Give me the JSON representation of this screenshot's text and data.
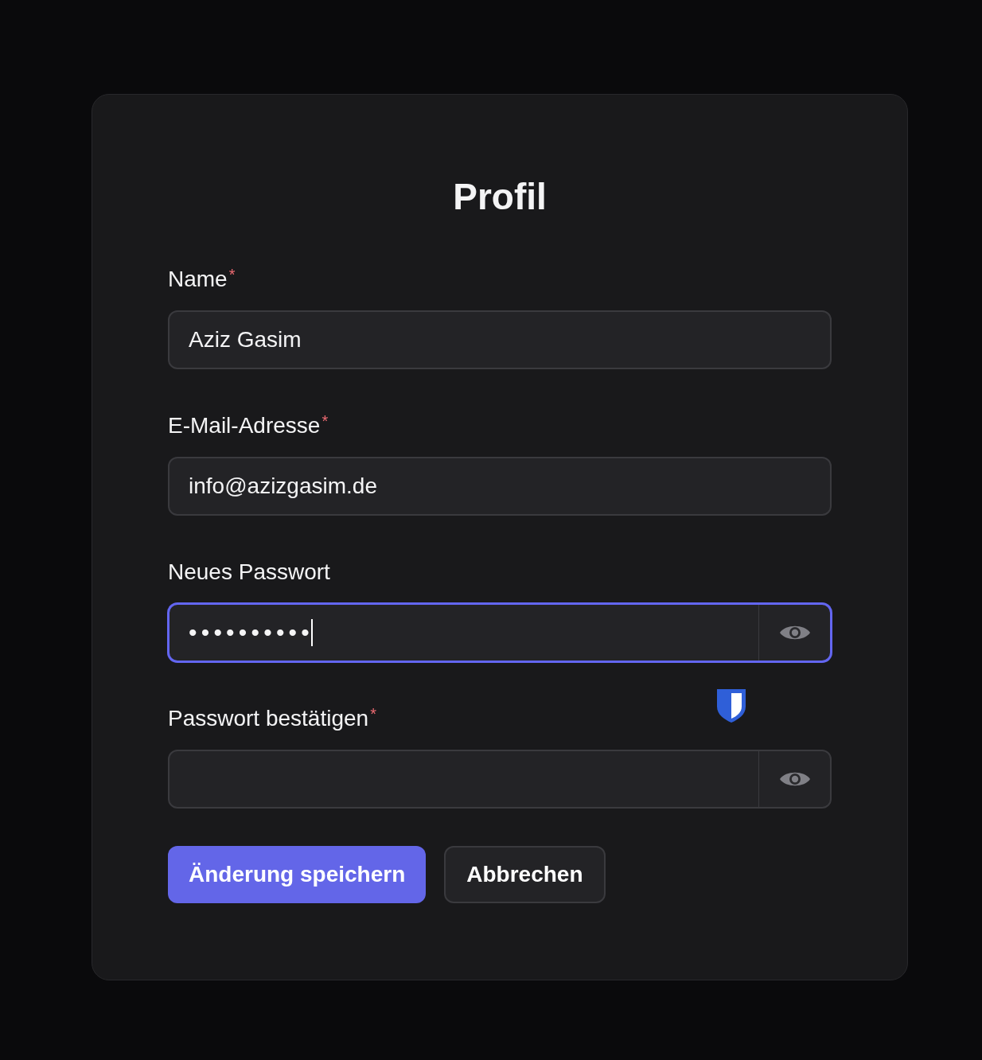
{
  "title": "Profil",
  "fields": [
    {
      "label": "Name",
      "required_mark": "*",
      "kind": "text",
      "value": "Aziz Gasim",
      "focused": false
    },
    {
      "label": "E-Mail-Adresse",
      "required_mark": "*",
      "kind": "email",
      "value": "info@azizgasim.de",
      "focused": false
    },
    {
      "label": "Neues Passwort",
      "kind": "password",
      "value": "••••••••••",
      "focused": true
    },
    {
      "label": "Passwort bestätigen",
      "required_mark": "*",
      "kind": "password",
      "focused": false
    }
  ],
  "buttons": [
    {
      "label": "Änderung speichern",
      "kind": "primary"
    },
    {
      "label": "Abbrechen",
      "kind": "secondary"
    }
  ]
}
